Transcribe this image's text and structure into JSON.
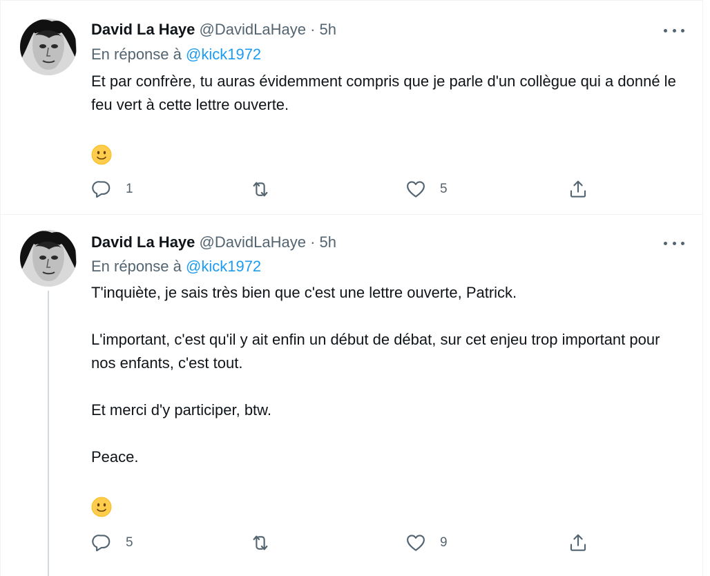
{
  "tweets": [
    {
      "author_name": "David La Haye",
      "author_handle": "@DavidLaHaye",
      "separator": "·",
      "time": "5h",
      "reply_prefix": "En réponse à",
      "reply_mention": "@kick1972",
      "paragraphs": [
        "Et par confrère, tu auras évidemment compris que je parle d'un collègue qui a donné le feu vert à cette lettre ouverte."
      ],
      "emoji": "slightly-smiling-face-icon",
      "reply_count": "1",
      "retweet_count": "",
      "like_count": "5"
    },
    {
      "author_name": "David La Haye",
      "author_handle": "@DavidLaHaye",
      "separator": "·",
      "time": "5h",
      "reply_prefix": "En réponse à",
      "reply_mention": "@kick1972",
      "paragraphs": [
        "T'inquiète, je sais très bien que c'est une lettre ouverte, Patrick.",
        "L'important, c'est qu'il y ait enfin un début de débat, sur cet enjeu trop important pour nos enfants, c'est tout.",
        "Et merci d'y participer, btw.",
        "Peace."
      ],
      "emoji": "slightly-smiling-face-icon",
      "reply_count": "5",
      "retweet_count": "",
      "like_count": "9"
    }
  ],
  "icons": {
    "reply": "reply-icon",
    "retweet": "retweet-icon",
    "like": "heart-icon",
    "share": "share-icon",
    "more": "more-icon"
  },
  "colors": {
    "text": "#0f1419",
    "secondary": "#536471",
    "mention": "#1d9bf0",
    "border": "#eff3f4",
    "thread_line": "#cfd9de"
  }
}
